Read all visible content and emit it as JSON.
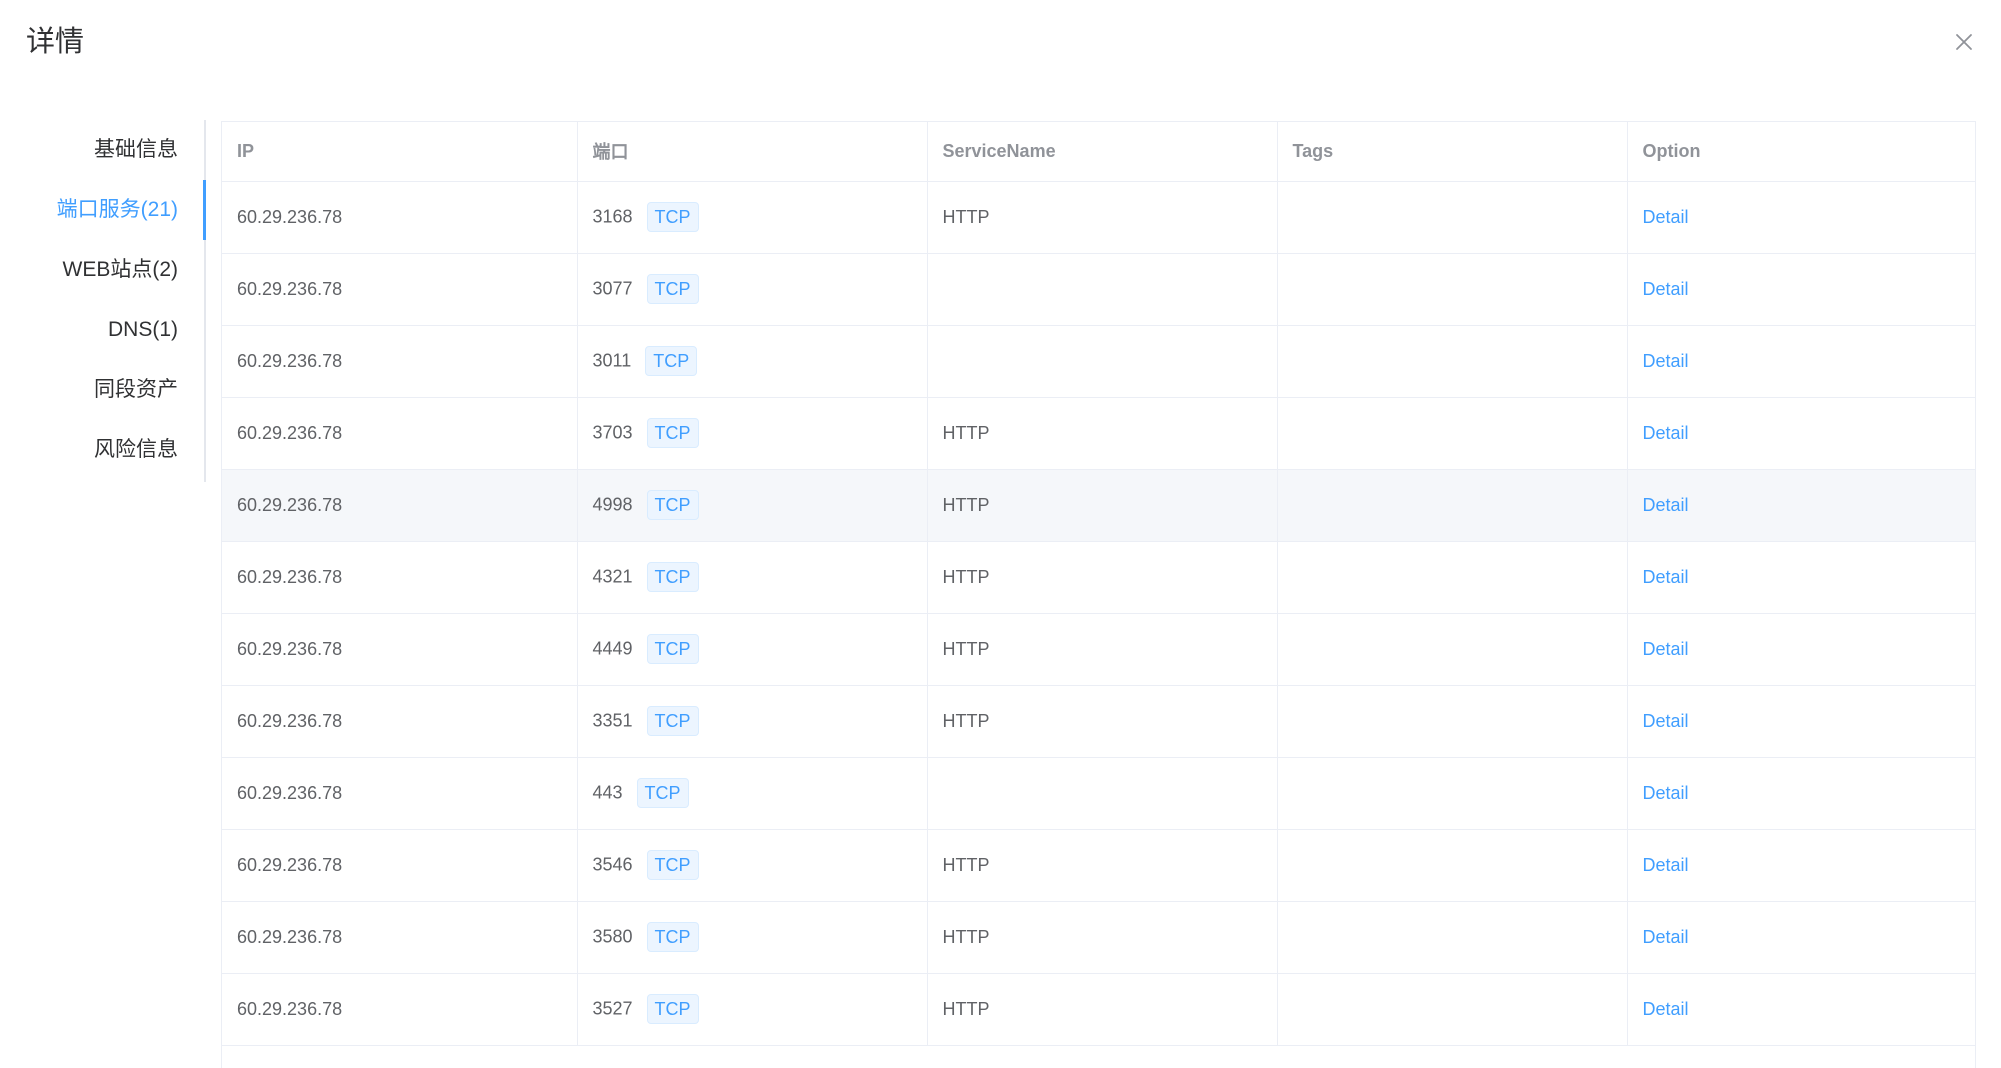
{
  "drawer": {
    "title": "详情",
    "close_icon": "close-icon"
  },
  "tabs": [
    {
      "label": "基础信息",
      "active": false
    },
    {
      "label": "端口服务(21)",
      "active": true
    },
    {
      "label": "WEB站点(2)",
      "active": false
    },
    {
      "label": "DNS(1)",
      "active": false
    },
    {
      "label": "同段资产",
      "active": false
    },
    {
      "label": "风险信息",
      "active": false
    }
  ],
  "table": {
    "columns": [
      "IP",
      "端口",
      "ServiceName",
      "Tags",
      "Option"
    ],
    "rows": [
      {
        "ip": "60.29.236.78",
        "port": "3168",
        "protocol": "TCP",
        "service": "HTTP",
        "tags": "",
        "option": "Detail"
      },
      {
        "ip": "60.29.236.78",
        "port": "3077",
        "protocol": "TCP",
        "service": "",
        "tags": "",
        "option": "Detail"
      },
      {
        "ip": "60.29.236.78",
        "port": "3011",
        "protocol": "TCP",
        "service": "",
        "tags": "",
        "option": "Detail"
      },
      {
        "ip": "60.29.236.78",
        "port": "3703",
        "protocol": "TCP",
        "service": "HTTP",
        "tags": "",
        "option": "Detail"
      },
      {
        "ip": "60.29.236.78",
        "port": "4998",
        "protocol": "TCP",
        "service": "HTTP",
        "tags": "",
        "option": "Detail",
        "hovered": true
      },
      {
        "ip": "60.29.236.78",
        "port": "4321",
        "protocol": "TCP",
        "service": "HTTP",
        "tags": "",
        "option": "Detail"
      },
      {
        "ip": "60.29.236.78",
        "port": "4449",
        "protocol": "TCP",
        "service": "HTTP",
        "tags": "",
        "option": "Detail"
      },
      {
        "ip": "60.29.236.78",
        "port": "3351",
        "protocol": "TCP",
        "service": "HTTP",
        "tags": "",
        "option": "Detail"
      },
      {
        "ip": "60.29.236.78",
        "port": "443",
        "protocol": "TCP",
        "service": "",
        "tags": "",
        "option": "Detail"
      },
      {
        "ip": "60.29.236.78",
        "port": "3546",
        "protocol": "TCP",
        "service": "HTTP",
        "tags": "",
        "option": "Detail"
      },
      {
        "ip": "60.29.236.78",
        "port": "3580",
        "protocol": "TCP",
        "service": "HTTP",
        "tags": "",
        "option": "Detail"
      },
      {
        "ip": "60.29.236.78",
        "port": "3527",
        "protocol": "TCP",
        "service": "HTTP",
        "tags": "",
        "option": "Detail"
      }
    ]
  },
  "colors": {
    "accent": "#409eff",
    "text_primary": "#303133",
    "text_regular": "#606266",
    "header_text": "#909399",
    "border": "#ebeef5",
    "hover_row": "#f5f7fa"
  }
}
